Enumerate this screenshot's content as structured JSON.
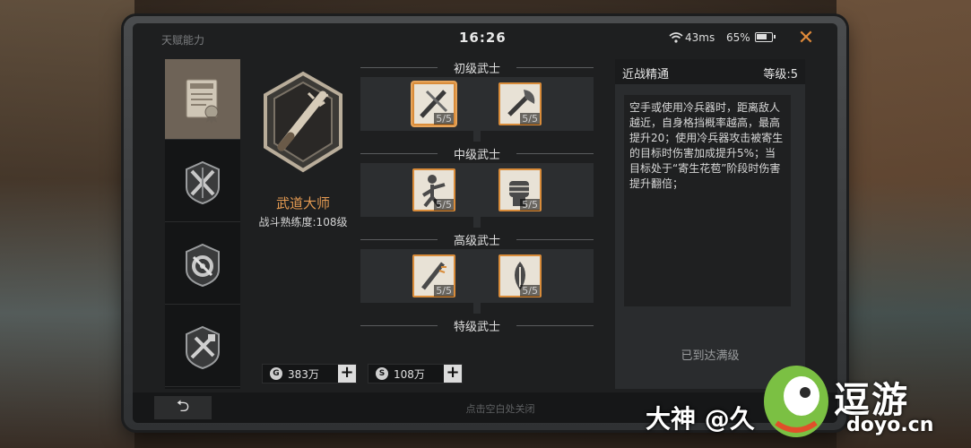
{
  "status": {
    "title": "天赋能力",
    "time": "16:26",
    "ping": "43ms",
    "battery": "65%"
  },
  "talent": {
    "name": "武道大师",
    "level_text": "战斗熟练度:108级"
  },
  "tiers": [
    {
      "label": "初级武士",
      "skills": [
        {
          "icon": "sword-slash-icon",
          "count": "5/5"
        },
        {
          "icon": "axe-icon",
          "count": "5/5"
        }
      ]
    },
    {
      "label": "中级武士",
      "skills": [
        {
          "icon": "fighter-icon",
          "count": "5/5"
        },
        {
          "icon": "fist-icon",
          "count": "5/5"
        }
      ]
    },
    {
      "label": "高级武士",
      "skills": [
        {
          "icon": "bat-strike-icon",
          "count": "5/5"
        },
        {
          "icon": "bud-icon",
          "count": "5/5"
        }
      ]
    },
    {
      "label": "特级武士",
      "skills": []
    }
  ],
  "currency": [
    {
      "icon": "G",
      "value": "383万"
    },
    {
      "icon": "S",
      "value": "108万"
    }
  ],
  "detail": {
    "name": "近战精通",
    "level": "等级:5",
    "description": "空手或使用冷兵器时，距离敌人越近，自身格挡概率越高，最高提升20；使用冷兵器攻击被寄生的目标时伤害加成提升5%；当目标处于“寄生花苞”阶段时伤害提升翻倍；",
    "status": "已到达满级"
  },
  "bottom": {
    "back": "⮌",
    "hint": "点击空白处关闭"
  },
  "watermark": {
    "text": "大神 @久",
    "brand": "逗游",
    "domain": "doyo.cn"
  },
  "colors": {
    "accent": "#e49a52",
    "active_tab": "#6e6357"
  }
}
